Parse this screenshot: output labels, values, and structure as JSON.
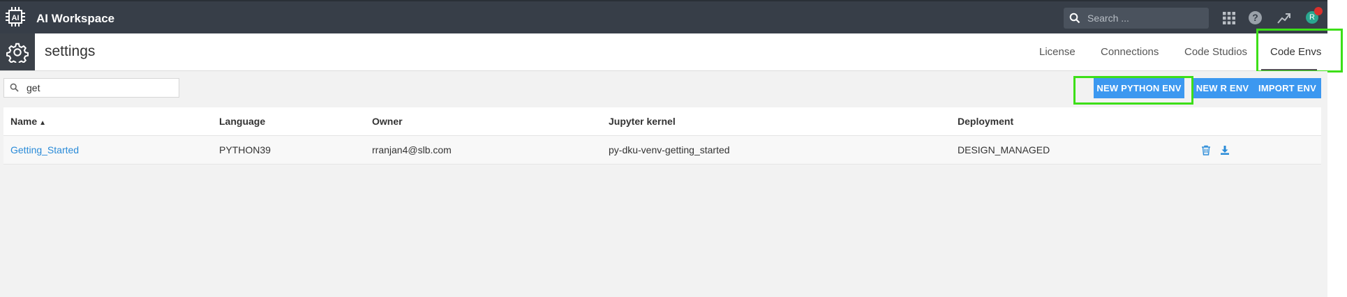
{
  "app": {
    "name": "AI Workspace",
    "logo_text": "AI"
  },
  "topbar": {
    "search_placeholder": "Search ...",
    "help_label": "?",
    "avatar_initial": "R"
  },
  "page": {
    "title": "settings"
  },
  "tabs": [
    {
      "label": "License"
    },
    {
      "label": "Connections"
    },
    {
      "label": "Code Studios"
    },
    {
      "label": "Code Envs"
    }
  ],
  "toolbar": {
    "filter_value": "get",
    "buttons": [
      {
        "label": "NEW PYTHON ENV"
      },
      {
        "label": "NEW R ENV"
      },
      {
        "label": "IMPORT ENV"
      }
    ]
  },
  "table": {
    "columns": [
      "Name",
      "Language",
      "Owner",
      "Jupyter kernel",
      "Deployment"
    ],
    "sort_arrow": "▲",
    "rows": [
      {
        "name": "Getting_Started",
        "language": "PYTHON39",
        "owner": "rranjan4@slb.com",
        "kernel": "py-dku-venv-getting_started",
        "deployment": "DESIGN_MANAGED"
      }
    ]
  },
  "colors": {
    "topbar": "#373e48",
    "accent": "#3c98f0",
    "link": "#2a8bd8",
    "highlight": "#3ddf18"
  }
}
